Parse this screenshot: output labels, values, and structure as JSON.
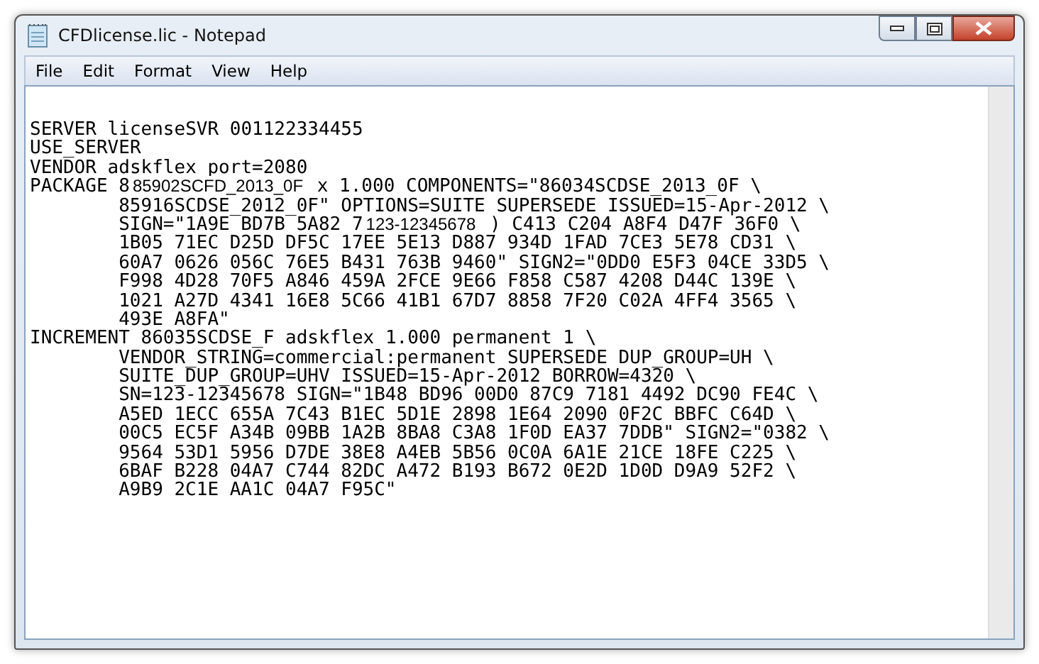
{
  "window": {
    "title": "CFDlicense.lic - Notepad"
  },
  "menu": [
    "File",
    "Edit",
    "Format",
    "View",
    "Help"
  ],
  "document": [
    {
      "parts": [
        {
          "kind": "text",
          "text": "SERVER licenseSVR 001122334455"
        }
      ]
    },
    {
      "parts": [
        {
          "kind": "text",
          "text": "USE_SERVER"
        }
      ]
    },
    {
      "parts": [
        {
          "kind": "text",
          "text": "VENDOR adskflex port=2080"
        }
      ]
    },
    {
      "parts": [
        {
          "kind": "text",
          "text": "PACKAGE 8"
        },
        {
          "kind": "patch",
          "text": "85902SCFD_2013_0F"
        },
        {
          "kind": "text",
          "text": " x 1.000 COMPONENTS=\"86034SCDSE_2013_0F \\"
        }
      ],
      "children": [
        {
          "parts": [
            {
              "kind": "text",
              "text": "85916SCDSE_2012_0F\" OPTIONS=SUITE SUPERSEDE ISSUED=15-Apr-2012 \\"
            }
          ]
        },
        {
          "parts": [
            {
              "kind": "text",
              "text": "SIGN=\"1A9E BD7B 5A82 7"
            },
            {
              "kind": "patch",
              "text": "123-12345678"
            },
            {
              "kind": "text",
              "text": " ) C413 C204 A8F4 D47F 36F0 \\"
            }
          ]
        },
        {
          "parts": [
            {
              "kind": "text",
              "text": "1B05 71EC D25D DF5C 17EE 5E13 D887 934D 1FAD 7CE3 5E78 CD31 \\"
            }
          ]
        },
        {
          "parts": [
            {
              "kind": "text",
              "text": "60A7 0626 056C 76E5 B431 763B 9460\" SIGN2=\"0DD0 E5F3 04CE 33D5 \\"
            }
          ]
        },
        {
          "parts": [
            {
              "kind": "text",
              "text": "F998 4D28 70F5 A846 459A 2FCE 9E66 F858 C587 4208 D44C 139E \\"
            }
          ]
        },
        {
          "parts": [
            {
              "kind": "text",
              "text": "1021 A27D 4341 16E8 5C66 41B1 67D7 8858 7F20 C02A 4FF4 3565 \\"
            }
          ]
        },
        {
          "parts": [
            {
              "kind": "text",
              "text": "493E A8FA\""
            }
          ]
        }
      ]
    },
    {
      "parts": [
        {
          "kind": "text",
          "text": "INCREMENT 86035SCDSE_F adskflex 1.000 permanent 1 \\"
        }
      ],
      "children": [
        {
          "parts": [
            {
              "kind": "text",
              "text": "VENDOR_STRING=commercial:permanent SUPERSEDE DUP_GROUP=UH \\"
            }
          ]
        },
        {
          "parts": [
            {
              "kind": "text",
              "text": "SUITE_DUP_GROUP=UHV ISSUED=15-Apr-2012 BORROW=4320 \\"
            }
          ]
        },
        {
          "parts": [
            {
              "kind": "text",
              "text": "SN=123-12345678 SIGN=\"1B48 BD96 00D0 87C9 7181 4492 DC90 FE4C \\"
            }
          ]
        },
        {
          "parts": [
            {
              "kind": "text",
              "text": "A5ED 1ECC 655A 7C43 B1EC 5D1E 2898 1E64 2090 0F2C BBFC C64D \\"
            }
          ]
        },
        {
          "parts": [
            {
              "kind": "text",
              "text": "00C5 EC5F A34B 09BB 1A2B 8BA8 C3A8 1F0D EA37 7DDB\" SIGN2=\"0382 \\"
            }
          ]
        },
        {
          "parts": [
            {
              "kind": "text",
              "text": "9564 53D1 5956 D7DE 38E8 A4EB 5B56 0C0A 6A1E 21CE 18FE C225 \\"
            }
          ]
        },
        {
          "parts": [
            {
              "kind": "text",
              "text": "6BAF B228 04A7 C744 82DC A472 B193 B672 0E2D 1D0D D9A9 52F2 \\"
            }
          ]
        },
        {
          "parts": [
            {
              "kind": "text",
              "text": "A9B9 2C1E AA1C 04A7 F95C\""
            }
          ]
        }
      ]
    }
  ]
}
